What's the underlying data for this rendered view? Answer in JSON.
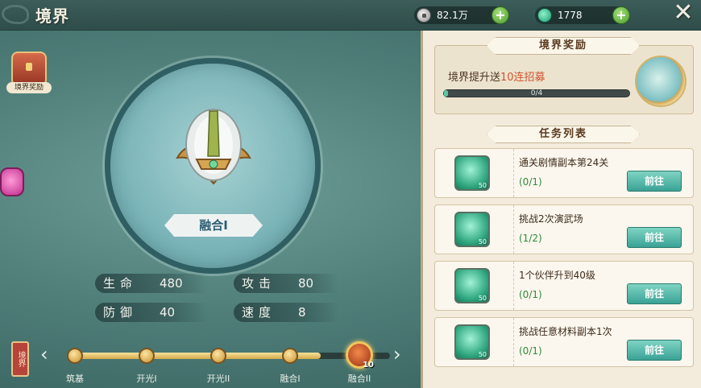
{
  "header": {
    "title": "境界",
    "coins": "82.1万",
    "gems": "1778",
    "add_label": "+",
    "close_label": "✕"
  },
  "side": {
    "reward_label": "境界奖励"
  },
  "rank": {
    "name": "融合I"
  },
  "stats": [
    {
      "label": "生命",
      "value": "480"
    },
    {
      "label": "攻击",
      "value": "80"
    },
    {
      "label": "防御",
      "value": "40"
    },
    {
      "label": "速度",
      "value": "8"
    }
  ],
  "track": {
    "seal_label": "境界",
    "stages": [
      "筑基",
      "开光I",
      "开光II",
      "融合I",
      "融合II"
    ],
    "current_level": "10",
    "progress_fraction": 0.78
  },
  "reward": {
    "header": "境界奖励",
    "text_prefix": "境界提升送",
    "text_highlight": "10连招募",
    "progress_text": "0/4",
    "progress_fraction": 0.02
  },
  "tasks": {
    "header": "任务列表",
    "items": [
      {
        "name": "通关剧情副本第24关",
        "progress": "(0/1)",
        "button": "前往",
        "qty": "50"
      },
      {
        "name": "挑战2次演武场",
        "progress": "(1/2)",
        "button": "前往",
        "qty": "50"
      },
      {
        "name": "1个伙伴升到40级",
        "progress": "(0/1)",
        "button": "前往",
        "qty": "50"
      },
      {
        "name": "挑战任意材料副本1次",
        "progress": "(0/1)",
        "button": "前往",
        "qty": "50"
      }
    ]
  },
  "colors": {
    "accent": "#3aa295",
    "highlight": "#d0542b",
    "progress_green": "#2f8a3a"
  }
}
